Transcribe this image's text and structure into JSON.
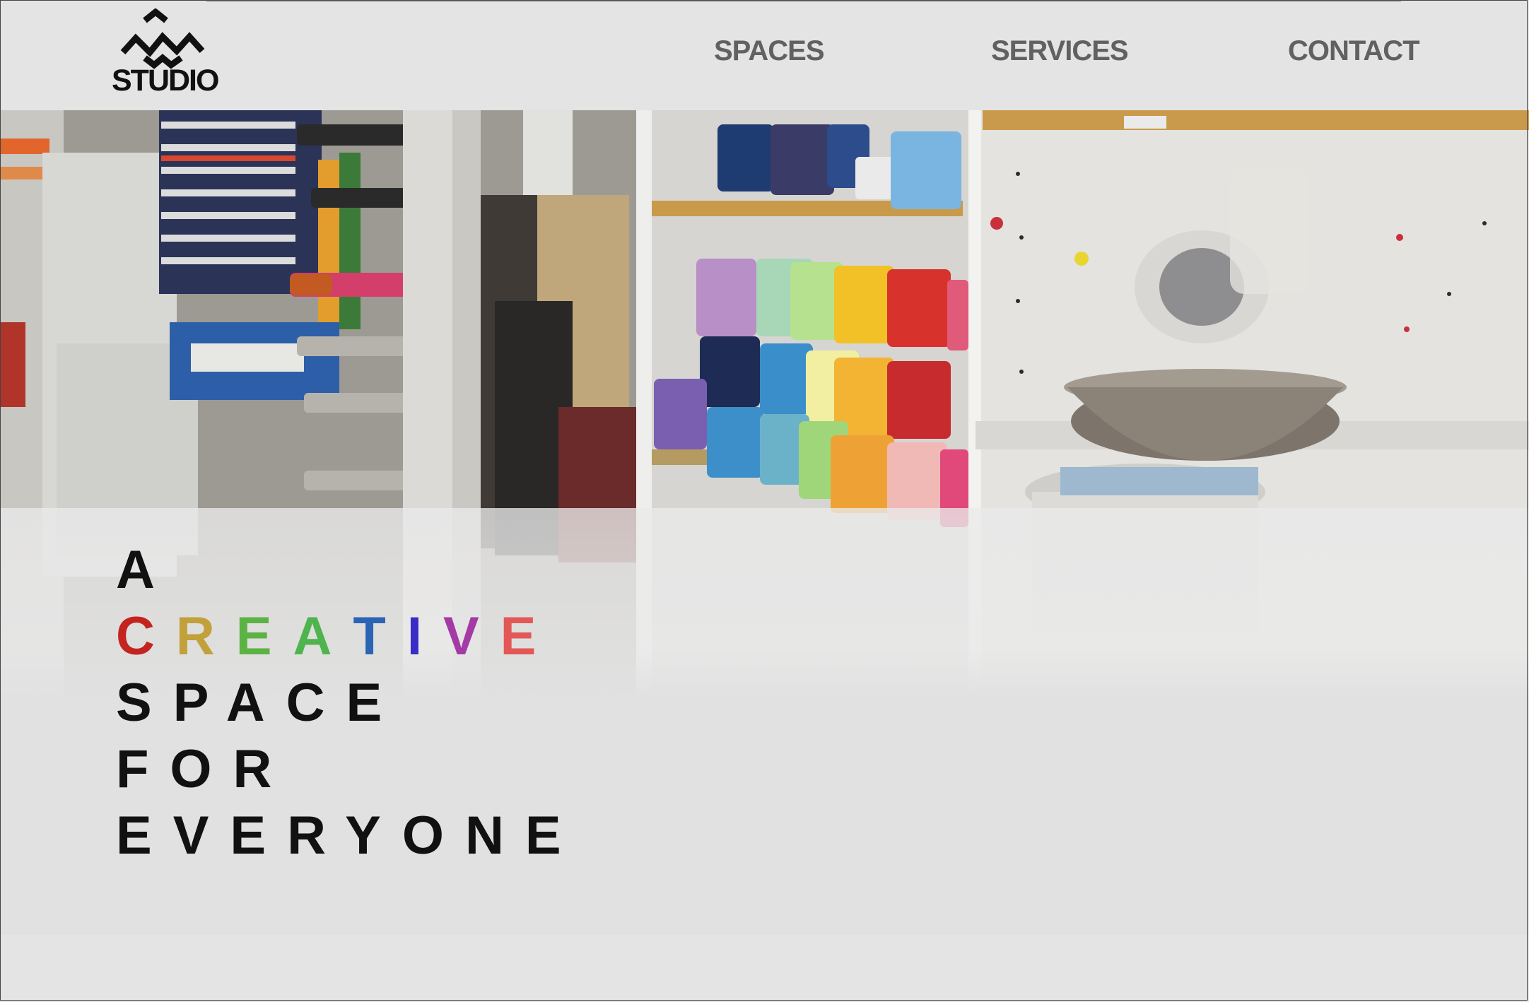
{
  "header": {
    "logo_text": "STUDIO",
    "nav": [
      "SPACES",
      "SERVICES",
      "CONTACT"
    ]
  },
  "hero": {
    "image_icon": "art-studio-shelves-photo",
    "tagline": {
      "line1": "A",
      "line2_letters": [
        "C",
        "R",
        "E",
        "A",
        "T",
        "I",
        "V",
        "E"
      ],
      "line2_colors": [
        "#c4231f",
        "#c2a03a",
        "#5bb343",
        "#4fb34e",
        "#2c64b5",
        "#3a2cc7",
        "#a33aa5",
        "#e35856"
      ],
      "line3": "SPACE",
      "line4": "FOR",
      "line5": "EVERYONE"
    }
  },
  "colors": {
    "background": "#e4e4e4",
    "nav_text": "#616161",
    "tagline_text": "#111111"
  }
}
